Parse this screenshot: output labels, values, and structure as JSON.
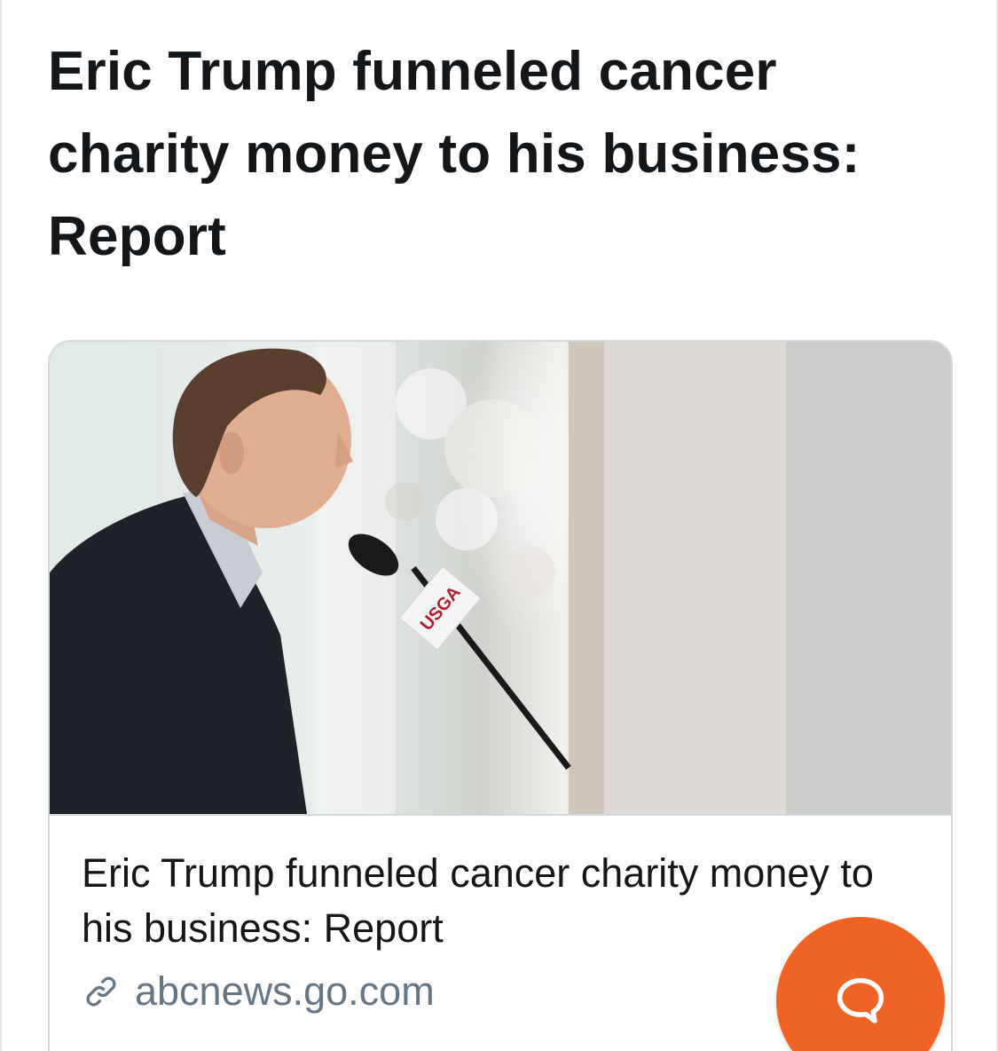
{
  "tweet": {
    "headline": "Eric Trump funneled cancer charity money to his business: Report"
  },
  "link_card": {
    "image_description": "",
    "image_logo_text": "USGA",
    "title": "Eric Trump funneled cancer charity money to his business: Report",
    "domain": "abcnews.go.com",
    "source_icon": "link-icon"
  },
  "fab": {
    "icon": "chat-bubble-icon",
    "color": "#f06325"
  },
  "colors": {
    "text_primary": "#14171a",
    "text_secondary": "#657786",
    "border": "#cfd9de",
    "accent": "#f06325"
  }
}
